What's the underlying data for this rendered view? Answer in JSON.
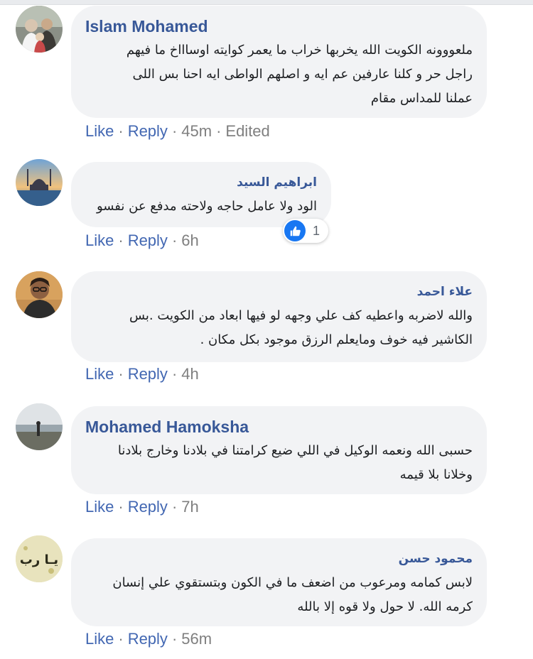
{
  "comments": [
    {
      "author": "Islam Mohamed",
      "lines": [
        "ملعووونه الكويت الله يخربها خراب ما يعمر كوايته اوساااخ ما فيهم",
        "راجل حر و كلنا عارفين عم ايه و اصلهم الواطى ايه احنا بس اللى",
        "عملنا للمداس مقام"
      ],
      "like": "Like",
      "reply": "Reply",
      "time": "45m",
      "edited": "Edited",
      "avatar_icon": "people-photo-avatar"
    },
    {
      "author": "ابراهيم السيد",
      "lines": [
        "الود ولا عامل حاجه ولاحته مدفع عن نفسو"
      ],
      "like": "Like",
      "reply": "Reply",
      "time": "6h",
      "reaction_count": "1",
      "avatar_icon": "mosque-sunset-avatar"
    },
    {
      "author": "علاء احمد",
      "lines": [
        "والله لاضربه واعطيه كف علي وجهه لو فيها ابعاد من الكويت .بس",
        "الكاشير فيه خوف ومايعلم الرزق موجود بكل مكان ."
      ],
      "like": "Like",
      "reply": "Reply",
      "time": "4h",
      "avatar_icon": "man-glasses-avatar"
    },
    {
      "author": "Mohamed Hamoksha",
      "lines": [
        "حسبى الله ونعمه الوكيل في اللي ضيع كرامتنا في بلادنا وخارج بلادنا",
        "وخلانا بلا قيمه"
      ],
      "like": "Like",
      "reply": "Reply",
      "time": "7h",
      "avatar_icon": "landscape-person-avatar"
    },
    {
      "author": "محمود حسن",
      "lines": [
        "لابس كمامه ومرعوب من اضعف ما في الكون وبتستقوي علي إنسان",
        "كرمه الله. لا حول ولا قوه إلا بالله"
      ],
      "like": "Like",
      "reply": "Reply",
      "time": "56m",
      "avatar_icon": "calligraphy-ya-rab-avatar",
      "avatar_text": "يـا رب"
    }
  ],
  "separator": "·",
  "colors": {
    "link": "#385898",
    "action": "#4267b2",
    "bubble": "#f2f3f5",
    "like_badge": "#1877f2"
  }
}
